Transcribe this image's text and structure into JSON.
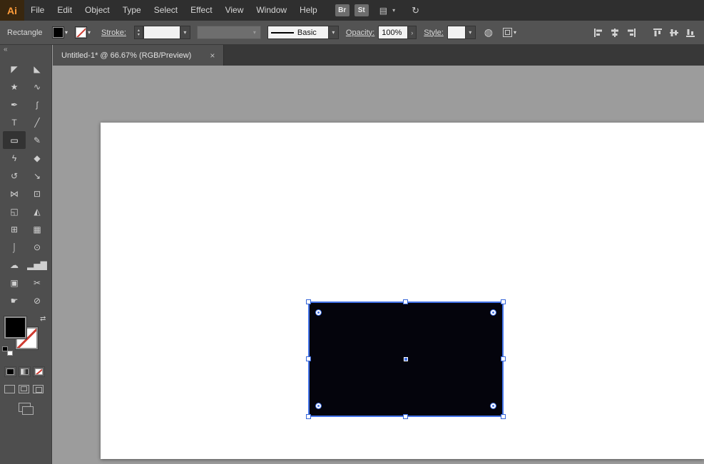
{
  "colors": {
    "selection_blue": "#4272e8",
    "none_red": "#cf3b31",
    "logo_orange": "#ff9c3a",
    "panel_gray": "#535353",
    "canvas_gray": "#9c9c9c"
  },
  "menubar": {
    "logo": "Ai",
    "items": [
      "File",
      "Edit",
      "Object",
      "Type",
      "Select",
      "Effect",
      "View",
      "Window",
      "Help"
    ],
    "bridge_label": "Br",
    "stock_label": "St",
    "workspace_icon": "▤",
    "workspace_caret": "▾",
    "sync_icon": "↻"
  },
  "controlbar": {
    "tool_name": "Rectangle",
    "fill_caret": "▾",
    "stroke_swatch_caret": "▾",
    "stroke_label": "Stroke:",
    "spinner_up": "▴",
    "spinner_down": "▾",
    "weight_caret": "▾",
    "brush_caret": "▾",
    "stroke_style_value": "Basic",
    "stroke_style_caret": "▾",
    "opacity_label": "Opacity:",
    "opacity_value": "100%",
    "opacity_arrow": "›",
    "style_label": "Style:",
    "style_caret": "▾",
    "recolor_icon": "◍",
    "shape_caret": "▾"
  },
  "tabbar": {
    "collapse_icon": "«",
    "title": "Untitled-1* @ 66.67% (RGB/Preview)",
    "close_icon": "×"
  },
  "toolbar": {
    "tools": [
      {
        "name": "selection",
        "glyph": "◤"
      },
      {
        "name": "direct-selection",
        "glyph": "◣"
      },
      {
        "name": "magic-wand",
        "glyph": "★"
      },
      {
        "name": "lasso",
        "glyph": "∿"
      },
      {
        "name": "pen",
        "glyph": "✒"
      },
      {
        "name": "curvature",
        "glyph": "ʃ"
      },
      {
        "name": "type",
        "glyph": "T"
      },
      {
        "name": "line-segment",
        "glyph": "╱"
      },
      {
        "name": "rectangle",
        "glyph": "▭",
        "selected": true
      },
      {
        "name": "paintbrush",
        "glyph": "✎"
      },
      {
        "name": "shaper",
        "glyph": "ϟ"
      },
      {
        "name": "eraser",
        "glyph": "◆"
      },
      {
        "name": "rotate",
        "glyph": "↺"
      },
      {
        "name": "scale",
        "glyph": "↘"
      },
      {
        "name": "width",
        "glyph": "⋈"
      },
      {
        "name": "free-transform",
        "glyph": "⊡"
      },
      {
        "name": "shape-builder",
        "glyph": "◱"
      },
      {
        "name": "perspective-grid",
        "glyph": "◭"
      },
      {
        "name": "mesh",
        "glyph": "⊞"
      },
      {
        "name": "gradient",
        "glyph": "▦"
      },
      {
        "name": "eyedropper",
        "glyph": "⌡"
      },
      {
        "name": "blend",
        "glyph": "⊙"
      },
      {
        "name": "symbol-sprayer",
        "glyph": "☁"
      },
      {
        "name": "column-graph",
        "glyph": "▂▅▇"
      },
      {
        "name": "artboard",
        "glyph": "▣"
      },
      {
        "name": "slice",
        "glyph": "✂"
      },
      {
        "name": "hand",
        "glyph": "☛"
      },
      {
        "name": "zoom",
        "glyph": "⊘"
      }
    ],
    "swap_icon": "⇄"
  }
}
